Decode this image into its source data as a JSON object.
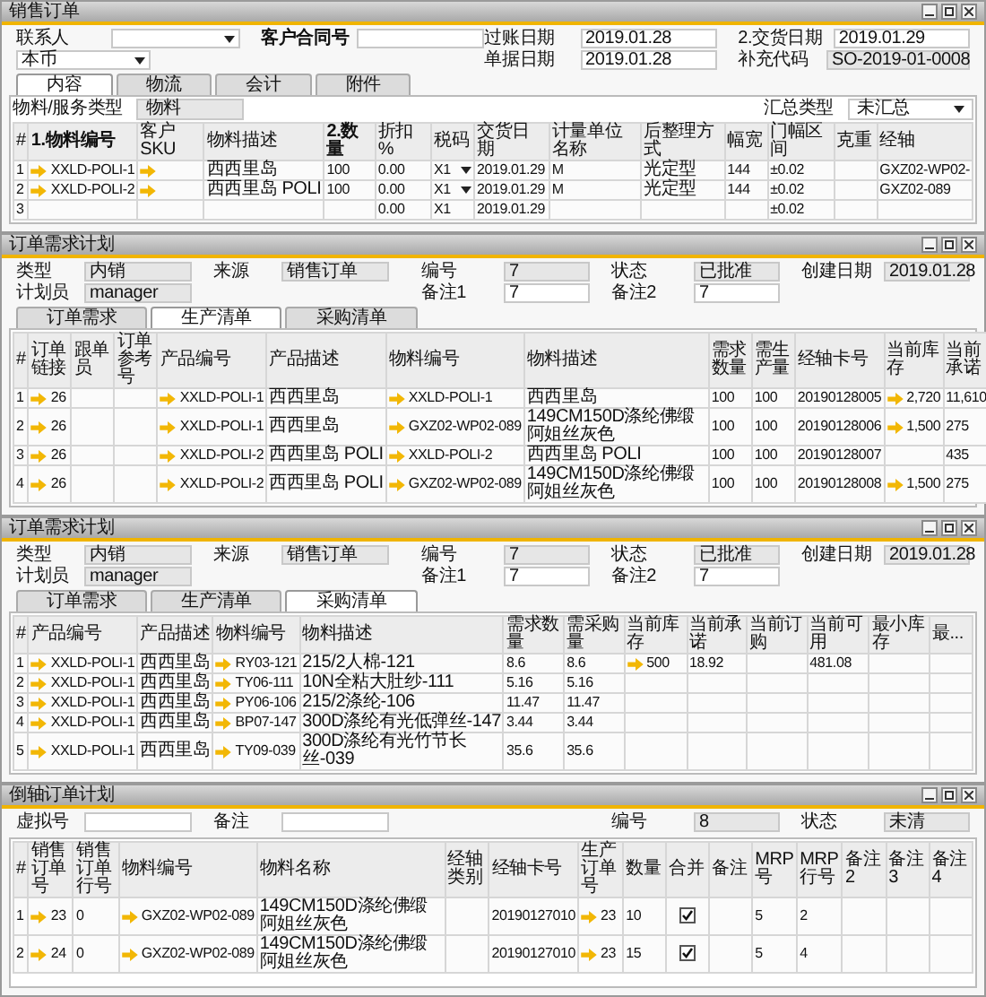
{
  "windows": [
    {
      "title": "销售订单",
      "left_fields": [
        {
          "label": "联系人",
          "kind": "dropdown"
        },
        {
          "label": "客户合同号",
          "kind": "input",
          "bold": true
        },
        {
          "value": "本币",
          "kind": "dropdown"
        }
      ],
      "right_fields": [
        {
          "label": "过账日期",
          "value": "2019.01.28",
          "kind": "input"
        },
        {
          "label": "2.交货日期",
          "value": "2019.01.29",
          "kind": "input"
        },
        {
          "label": "单据日期",
          "value": "2019.01.28",
          "kind": "input"
        },
        {
          "label": "补充代码",
          "value": "SO-2019-01-0008",
          "kind": "readonly"
        }
      ],
      "tabs": [
        {
          "label": "内容",
          "selected": true
        },
        {
          "label": "物流",
          "selected": false
        },
        {
          "label": "会计",
          "selected": false
        },
        {
          "label": "附件",
          "selected": false
        }
      ],
      "toolbar": {
        "left": {
          "label": "物料/服务类型",
          "value": "物料"
        },
        "right": {
          "label": "汇总类型",
          "value": "未汇总"
        }
      },
      "columns": [
        {
          "label": "#"
        },
        {
          "label": "1.物料编号",
          "bold": true
        },
        {
          "label": "客户SKU"
        },
        {
          "label": "物料描述"
        },
        {
          "label": "2.数量",
          "bold": true
        },
        {
          "label": "折扣 %"
        },
        {
          "label": "税码"
        },
        {
          "label": "交货日期"
        },
        {
          "label": "计量单位名称"
        },
        {
          "label": "后整理方式"
        },
        {
          "label": "幅宽"
        },
        {
          "label": "门幅区间"
        },
        {
          "label": "克重"
        },
        {
          "label": "经轴"
        }
      ],
      "rows": [
        [
          "1",
          {
            "text": "XXLD-POLI-1",
            "link": true
          },
          {
            "link": true
          },
          "西西里岛",
          "100",
          "0.00",
          {
            "text": "X1",
            "dropdown": true
          },
          "2019.01.29",
          "M",
          "光定型",
          "144",
          "±0.02",
          null,
          "GXZ02-WP02-"
        ],
        [
          "2",
          {
            "text": "XXLD-POLI-2",
            "link": true
          },
          {
            "link": true
          },
          "西西里岛 POLI",
          "100",
          "0.00",
          {
            "text": "X1",
            "dropdown": true
          },
          "2019.01.29",
          "M",
          "光定型",
          "144",
          "±0.02",
          null,
          "GXZ02-089"
        ],
        [
          "3",
          null,
          null,
          null,
          null,
          "0.00",
          "X1",
          "2019.01.29",
          null,
          null,
          null,
          "±0.02",
          null,
          null
        ]
      ]
    },
    {
      "title": "订单需求计划",
      "left_fields": [
        {
          "label": "类型",
          "value": "内销",
          "kind": "readonly"
        },
        {
          "label": "来源",
          "value": "销售订单",
          "kind": "readonly"
        },
        {
          "label": "计划员",
          "value": "manager",
          "kind": "readonly"
        }
      ],
      "right_fields": [
        {
          "label": "编号",
          "value": "7",
          "kind": "readonly"
        },
        {
          "label": "状态",
          "value": "已批准",
          "kind": "readonly"
        },
        {
          "label": "创建日期",
          "value": "2019.01.28",
          "kind": "readonly"
        },
        {
          "label": "备注1",
          "value": "7",
          "kind": "input"
        },
        {
          "label": "备注2",
          "value": "7",
          "kind": "input"
        }
      ],
      "tabs": [
        {
          "label": "订单需求",
          "selected": false
        },
        {
          "label": "生产清单",
          "selected": true
        },
        {
          "label": "采购清单",
          "selected": false
        }
      ],
      "columns": [
        {
          "label": "#"
        },
        {
          "label": "订单链接"
        },
        {
          "label": "跟单员"
        },
        {
          "label": "订单参考号"
        },
        {
          "label": "产品编号"
        },
        {
          "label": "产品描述"
        },
        {
          "label": "物料编号"
        },
        {
          "label": "物料描述"
        },
        {
          "label": "需求数量"
        },
        {
          "label": "需生产量"
        },
        {
          "label": "经轴卡号"
        },
        {
          "label": "当前库存"
        },
        {
          "label": "当前承诺"
        }
      ],
      "rows": [
        [
          "1",
          {
            "text": "26",
            "link": true
          },
          null,
          null,
          {
            "text": "XXLD-POLI-1",
            "link": true
          },
          "西西里岛",
          {
            "text": "XXLD-POLI-1",
            "link": true
          },
          "西西里岛",
          "100",
          "100",
          "20190128005",
          {
            "text": "2,720",
            "link": true
          },
          "11,610"
        ],
        [
          "2",
          {
            "text": "26",
            "link": true
          },
          null,
          null,
          {
            "text": "XXLD-POLI-1",
            "link": true
          },
          "西西里岛",
          {
            "text": "GXZ02-WP02-089",
            "link": true
          },
          "149CM150D涤纶佛缎阿姐丝灰色",
          "100",
          "100",
          "20190128006",
          {
            "text": "1,500",
            "link": true
          },
          "275"
        ],
        [
          "3",
          {
            "text": "26",
            "link": true
          },
          null,
          null,
          {
            "text": "XXLD-POLI-2",
            "link": true
          },
          "西西里岛 POLI",
          {
            "text": "XXLD-POLI-2",
            "link": true
          },
          "西西里岛 POLI",
          "100",
          "100",
          "20190128007",
          null,
          "435"
        ],
        [
          "4",
          {
            "text": "26",
            "link": true
          },
          null,
          null,
          {
            "text": "XXLD-POLI-2",
            "link": true
          },
          "西西里岛 POLI",
          {
            "text": "GXZ02-WP02-089",
            "link": true
          },
          "149CM150D涤纶佛缎阿姐丝灰色",
          "100",
          "100",
          "20190128008",
          {
            "text": "1,500",
            "link": true
          },
          "275"
        ]
      ]
    },
    {
      "title": "订单需求计划",
      "left_fields": [
        {
          "label": "类型",
          "value": "内销",
          "kind": "readonly"
        },
        {
          "label": "来源",
          "value": "销售订单",
          "kind": "readonly"
        },
        {
          "label": "计划员",
          "value": "manager",
          "kind": "readonly"
        }
      ],
      "right_fields": [
        {
          "label": "编号",
          "value": "7",
          "kind": "readonly"
        },
        {
          "label": "状态",
          "value": "已批准",
          "kind": "readonly"
        },
        {
          "label": "创建日期",
          "value": "2019.01.28",
          "kind": "readonly"
        },
        {
          "label": "备注1",
          "value": "7",
          "kind": "input"
        },
        {
          "label": "备注2",
          "value": "7",
          "kind": "input"
        }
      ],
      "tabs": [
        {
          "label": "订单需求",
          "selected": false
        },
        {
          "label": "生产清单",
          "selected": false
        },
        {
          "label": "采购清单",
          "selected": true
        }
      ],
      "columns": [
        {
          "label": "#"
        },
        {
          "label": "产品编号"
        },
        {
          "label": "产品描述"
        },
        {
          "label": "物料编号"
        },
        {
          "label": "物料描述"
        },
        {
          "label": "需求数量"
        },
        {
          "label": "需采购量"
        },
        {
          "label": "当前库存"
        },
        {
          "label": "当前承诺"
        },
        {
          "label": "当前订购"
        },
        {
          "label": "当前可用"
        },
        {
          "label": "最小库存"
        },
        {
          "label": "最..."
        }
      ],
      "rows": [
        [
          "1",
          {
            "text": "XXLD-POLI-1",
            "link": true
          },
          "西西里岛",
          {
            "text": "RY03-121",
            "link": true
          },
          "215/2人棉-121",
          "8.6",
          "8.6",
          {
            "text": "500",
            "link": true
          },
          "18.92",
          null,
          "481.08",
          null,
          null
        ],
        [
          "2",
          {
            "text": "XXLD-POLI-1",
            "link": true
          },
          "西西里岛",
          {
            "text": "TY06-111",
            "link": true
          },
          "10N全粘大肚纱-111",
          "5.16",
          "5.16",
          null,
          null,
          null,
          null,
          null,
          null
        ],
        [
          "3",
          {
            "text": "XXLD-POLI-1",
            "link": true
          },
          "西西里岛",
          {
            "text": "PY06-106",
            "link": true
          },
          "215/2涤纶-106",
          "11.47",
          "11.47",
          null,
          null,
          null,
          null,
          null,
          null
        ],
        [
          "4",
          {
            "text": "XXLD-POLI-1",
            "link": true
          },
          "西西里岛",
          {
            "text": "BP07-147",
            "link": true
          },
          "300D涤纶有光低弹丝-147",
          "3.44",
          "3.44",
          null,
          null,
          null,
          null,
          null,
          null
        ],
        [
          "5",
          {
            "text": "XXLD-POLI-1",
            "link": true
          },
          "西西里岛",
          {
            "text": "TY09-039",
            "link": true
          },
          "300D涤纶有光竹节长丝-039",
          "35.6",
          "35.6",
          null,
          null,
          null,
          null,
          null,
          null
        ]
      ]
    },
    {
      "title": "倒轴订单计划",
      "left_fields": [
        {
          "label": "虚拟号",
          "kind": "input"
        },
        {
          "label": "备注",
          "kind": "input"
        }
      ],
      "right_fields": [
        {
          "label": "编号",
          "value": "8",
          "kind": "readonly"
        },
        {
          "label": "状态",
          "value": "未清",
          "kind": "readonly"
        }
      ],
      "columns": [
        {
          "label": "#"
        },
        {
          "label": "销售订单号"
        },
        {
          "label": "销售订单行号"
        },
        {
          "label": "物料编号"
        },
        {
          "label": "物料名称"
        },
        {
          "label": "经轴类别"
        },
        {
          "label": "经轴卡号"
        },
        {
          "label": "生产订单号"
        },
        {
          "label": "数量"
        },
        {
          "label": "合并"
        },
        {
          "label": "备注"
        },
        {
          "label": "MRP号"
        },
        {
          "label": "MRP行号"
        },
        {
          "label": "备注2"
        },
        {
          "label": "备注3"
        },
        {
          "label": "备注4"
        }
      ],
      "rows": [
        [
          "1",
          {
            "text": "23",
            "link": true
          },
          "0",
          {
            "text": "GXZ02-WP02-089",
            "link": true
          },
          "149CM150D涤纶佛缎阿姐丝灰色",
          null,
          "20190127010",
          {
            "text": "23",
            "link": true
          },
          "10",
          {
            "checked": true
          },
          null,
          "5",
          "2",
          null,
          null,
          null
        ],
        [
          "2",
          {
            "text": "24",
            "link": true
          },
          "0",
          {
            "text": "GXZ02-WP02-089",
            "link": true
          },
          "149CM150D涤纶佛缎阿姐丝灰色",
          null,
          "20190127010",
          {
            "text": "23",
            "link": true
          },
          "15",
          {
            "checked": true
          },
          null,
          "5",
          "4",
          null,
          null,
          null
        ]
      ]
    }
  ]
}
